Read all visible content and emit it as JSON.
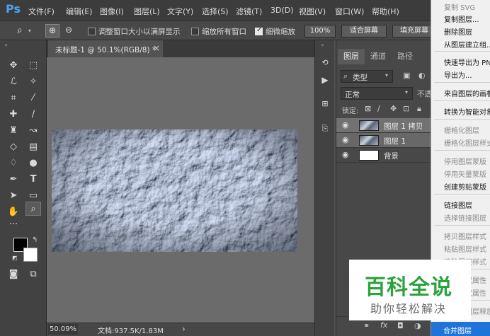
{
  "app": {
    "logo": "Ps"
  },
  "menu": [
    "文件(F)",
    "编辑(E)",
    "图像(I)",
    "图层(L)",
    "文字(Y)",
    "选择(S)",
    "滤镜(T)",
    "3D(D)",
    "视图(V)",
    "窗口(W)",
    "帮助(H)"
  ],
  "options": {
    "resize_windows_label": "调整窗口大小以满屏显示",
    "zoom_all_label": "缩放所有窗口",
    "scrubby_label": "细微缩放",
    "zoom_value": "100%",
    "fit_screen": "适合屏幕",
    "fill_screen": "填充屏幕"
  },
  "document": {
    "tab_title": "未标题-1 @ 50.1%(RGB/8) *",
    "close": "×"
  },
  "status": {
    "zoom": "50.09%",
    "doc_info": "文档:937.5K/1.83M",
    "arrow": "›"
  },
  "layers_panel": {
    "tabs": [
      "图层",
      "通道",
      "路径"
    ],
    "filter_kind": "类型",
    "blend_mode": "正常",
    "opacity_label": "不透",
    "lock_label": "锁定:",
    "layers": [
      {
        "name": "图层 1 拷贝",
        "selected": true
      },
      {
        "name": "图层 1",
        "selected": true
      },
      {
        "name": "背景",
        "selected": false
      }
    ],
    "footer_icons": [
      "link-icon",
      "fx-icon",
      "mask-icon",
      "adjustment-icon"
    ]
  },
  "context_menu": {
    "items": [
      {
        "label": "复制 SVG",
        "disabled": true
      },
      {
        "label": "复制图层...",
        "disabled": false
      },
      {
        "label": "删除图层",
        "disabled": false
      },
      {
        "label": "从图层建立组...",
        "disabled": false
      },
      {
        "label": "快速导出为 PNG",
        "disabled": false
      },
      {
        "label": "导出为...",
        "disabled": false
      },
      {
        "label": "来自图层的画板...",
        "disabled": false
      },
      {
        "label": "转换为智能对象",
        "disabled": false
      },
      {
        "label": "栅格化图层",
        "disabled": true
      },
      {
        "label": "栅格化图层样式",
        "disabled": true
      },
      {
        "label": "停用图层蒙版",
        "disabled": true
      },
      {
        "label": "停用矢量蒙版",
        "disabled": true
      },
      {
        "label": "创建剪贴蒙版",
        "disabled": false
      },
      {
        "label": "链接图层",
        "disabled": false
      },
      {
        "label": "选择链接图层",
        "disabled": true
      },
      {
        "label": "拷贝图层样式",
        "disabled": true
      },
      {
        "label": "粘贴图层样式",
        "disabled": true
      },
      {
        "label": "清除图层样式",
        "disabled": true
      },
      {
        "label": "复制形状属性",
        "disabled": true
      },
      {
        "label": "粘贴形状属性",
        "disabled": true
      },
      {
        "label": "从隔离图层释放",
        "disabled": true
      },
      {
        "label": "合并图层",
        "disabled": false
      }
    ]
  },
  "watermark": {
    "title": "百科全说",
    "subtitle": "助你轻松解决"
  },
  "colors": {
    "accent": "#1e74d9",
    "ps_blue": "#4ba2ef",
    "watermark_green": "#2aa33c"
  }
}
